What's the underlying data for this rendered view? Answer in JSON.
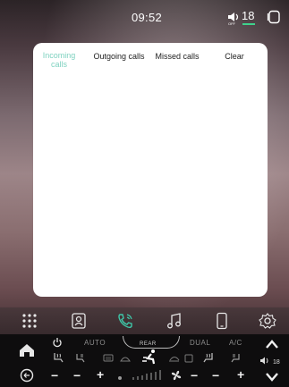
{
  "status": {
    "time": "09:52",
    "volume_state": "OFF",
    "temperature": "18",
    "indicator_color": "#3fd28c"
  },
  "calls": {
    "tabs": [
      {
        "label": "Incoming\ncalls",
        "active": true
      },
      {
        "label": "Outgoing calls",
        "active": false
      },
      {
        "label": "Missed calls",
        "active": false
      },
      {
        "label": "Clear",
        "active": false
      }
    ],
    "active_color": "#7fd2c0"
  },
  "dock": {
    "items": [
      "apps-grid-icon",
      "contacts-icon",
      "phone-icon",
      "music-note-icon",
      "mobile-icon",
      "settings-gear-icon"
    ],
    "active_item": "phone-icon",
    "active_color": "#3ec7a8"
  },
  "climate": {
    "auto_label": "AUTO",
    "rear_label": "REAR",
    "dual_label": "DUAL",
    "ac_label": "A/C",
    "volume_level": "18",
    "left_minus": "−",
    "left_minus2": "−",
    "left_plus": "+",
    "right_minus": "−",
    "right_minus2": "−",
    "right_plus": "+"
  }
}
